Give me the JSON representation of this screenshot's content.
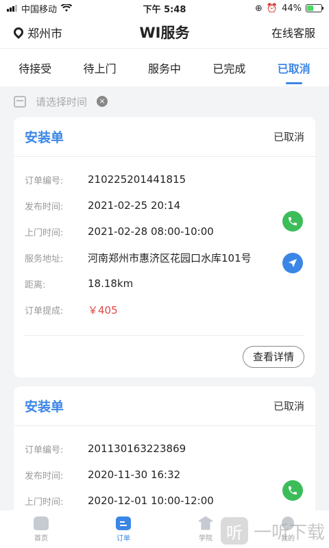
{
  "status_bar": {
    "carrier": "中国移动",
    "time": "下午 5:48",
    "battery": "44%"
  },
  "header": {
    "location": "郑州市",
    "title": "WI服务",
    "service": "在线客服"
  },
  "tabs": [
    {
      "label": "待接受"
    },
    {
      "label": "待上门"
    },
    {
      "label": "服务中"
    },
    {
      "label": "已完成"
    },
    {
      "label": "已取消"
    }
  ],
  "filter": {
    "placeholder": "请选择时间"
  },
  "labels": {
    "order_no": "订单编号:",
    "publish_time": "发布时间:",
    "visit_time": "上门时间:",
    "address": "服务地址:",
    "distance": "距离:",
    "commission": "订单提成:"
  },
  "orders": [
    {
      "type": "安装单",
      "status": "已取消",
      "order_no": "210225201441815",
      "publish_time": "2021-02-25 20:14",
      "visit_time": "2021-02-28 08:00-10:00",
      "address": "河南郑州市惠济区花园口水库101号",
      "distance": "18.18km",
      "commission": "￥405",
      "detail_label": "查看详情"
    },
    {
      "type": "安装单",
      "status": "已取消",
      "order_no": "201130163223869",
      "publish_time": "2020-11-30 16:32",
      "visit_time": "2020-12-01 10:00-12:00"
    }
  ],
  "bottom_nav": [
    {
      "label": "首页"
    },
    {
      "label": "订单"
    },
    {
      "label": "学院"
    },
    {
      "label": "我的"
    }
  ],
  "watermark": {
    "glyph": "听",
    "text": "一听下载"
  },
  "colors": {
    "accent": "#3a86e6",
    "phone": "#3dbd5a",
    "price": "#e04646"
  }
}
